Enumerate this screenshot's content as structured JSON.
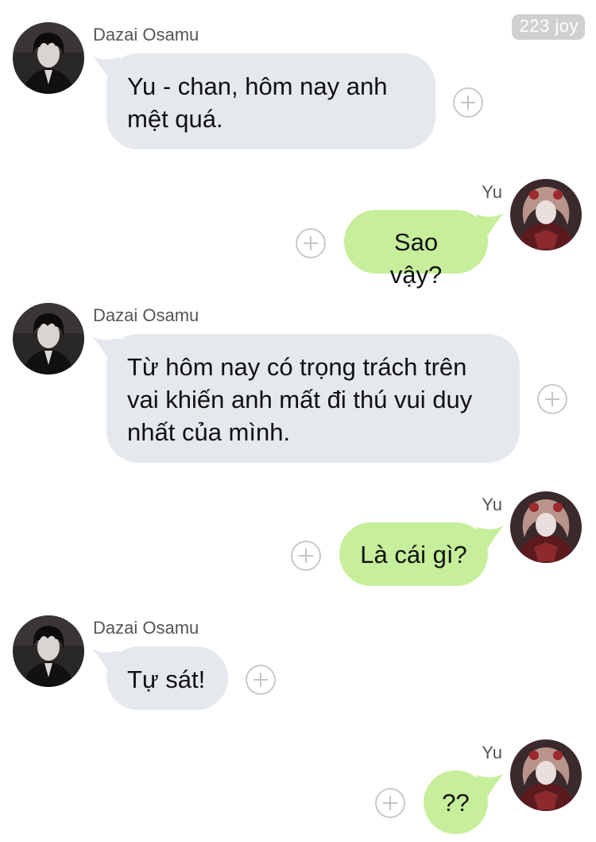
{
  "watermark": "223 joy",
  "contacts": {
    "dazai": {
      "name": "Dazai Osamu",
      "avatar_icon": "dazai-avatar"
    },
    "yu": {
      "name": "Yu",
      "avatar_icon": "yu-avatar"
    }
  },
  "colors": {
    "incoming_bubble": "#e5e8ec",
    "outgoing_bubble": "#c6ee9b",
    "background": "#ffffff"
  },
  "messages": [
    {
      "sender": "Dazai Osamu",
      "direction": "incoming",
      "text": "Yu - chan, hôm nay anh mệt quá."
    },
    {
      "sender": "Yu",
      "direction": "outgoing",
      "text": "Sao vậy?"
    },
    {
      "sender": "Dazai Osamu",
      "direction": "incoming",
      "text": "Từ hôm nay có trọng trách trên vai khiến anh mất đi thú vui duy nhất của mình."
    },
    {
      "sender": "Yu",
      "direction": "outgoing",
      "text": "Là cái gì?"
    },
    {
      "sender": "Dazai Osamu",
      "direction": "incoming",
      "text": "Tự sát!"
    },
    {
      "sender": "Yu",
      "direction": "outgoing",
      "text": "??"
    }
  ]
}
